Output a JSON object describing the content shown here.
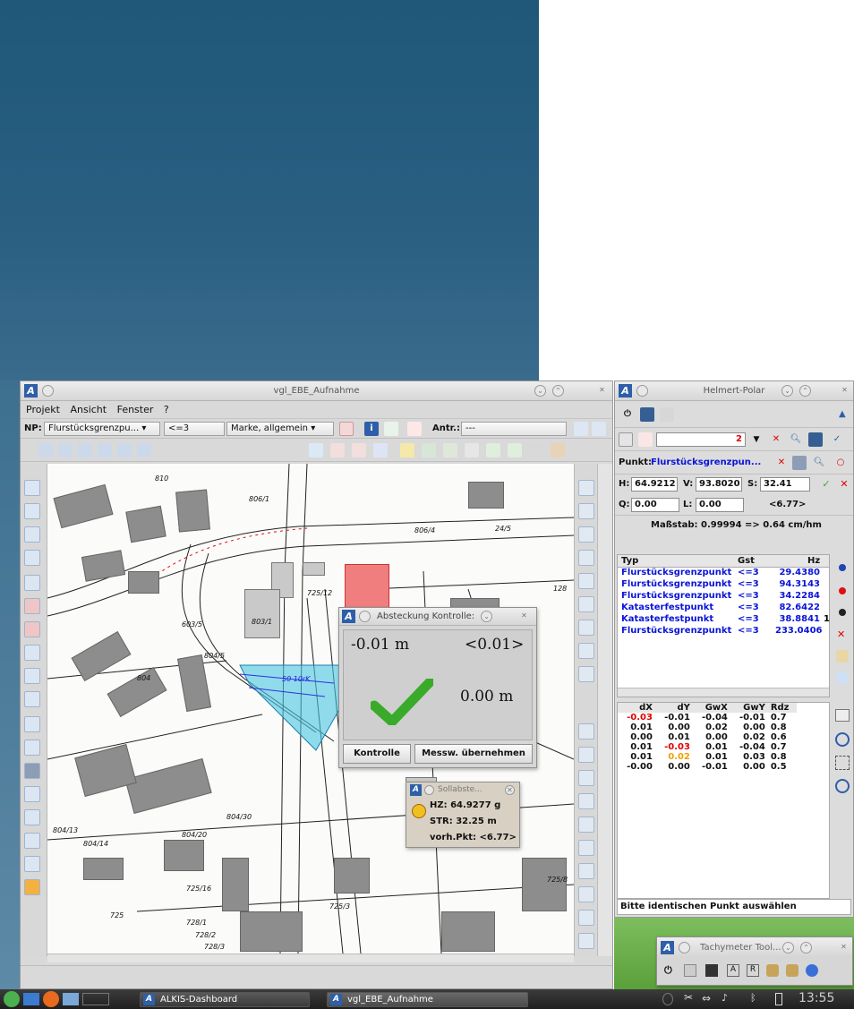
{
  "main_window": {
    "title": "vgl_EBE_Aufnahme",
    "menu": [
      "Projekt",
      "Ansicht",
      "Fenster",
      "?"
    ],
    "np_label": "NP:",
    "np_value": "Flurstücksgrenzpu...",
    "filter_value": "<=3",
    "marker_value": "Marke, allgemein",
    "antr_label": "Antr.:",
    "antr_value": "---"
  },
  "map_labels": [
    "810",
    "806/1",
    "806/4",
    "24/5",
    "725/12",
    "803/1",
    "128",
    "804",
    "603/5",
    "804/5",
    "804/13",
    "804/14",
    "804/20",
    "804/30",
    "725/3",
    "725/16",
    "725",
    "728/1",
    "728/2",
    "728/3",
    "725/8",
    "50 10rK"
  ],
  "absteckung": {
    "title": "Absteckung Kontrolle:",
    "value1": "-0.01 m",
    "value2": "<0.01>",
    "value3": "0.00 m",
    "button_kontrolle": "Kontrolle",
    "button_uebernehmen": "Messw. übernehmen"
  },
  "sollabsteckung": {
    "title": "Sollabste...",
    "hz": "HZ: 64.9277 g",
    "str": "STR: 32.25 m",
    "vorh": "vorh.Pkt: <6.77>"
  },
  "helmert": {
    "title": "Helmert-Polar",
    "combo_value": "2",
    "punkt_label": "Punkt:",
    "punkt_value": "Flurstücksgrenzpun...",
    "h_label": "H:",
    "h_value": "64.9212",
    "v_label": "V:",
    "v_value": "93.8020",
    "s_label": "S:",
    "s_value": "32.41",
    "q_label": "Q:",
    "q_value": "0.00",
    "l_label": "L:",
    "l_value": "0.00",
    "extra": "<6.77>",
    "massstab": "Maßstab: 0.99994 => 0.64 cm/hm",
    "columns": [
      "Typ",
      "Gst",
      "Hz"
    ],
    "rows": [
      {
        "typ": "Flurstücksgrenzpunkt",
        "gst": "<=3",
        "hz": "29.4380"
      },
      {
        "typ": "Flurstücksgrenzpunkt",
        "gst": "<=3",
        "hz": "94.3143"
      },
      {
        "typ": "Flurstücksgrenzpunkt",
        "gst": "<=3",
        "hz": "34.2284"
      },
      {
        "typ": "Katasterfestpunkt",
        "gst": "<=3",
        "hz": "82.6422"
      },
      {
        "typ": "Katasterfestpunkt",
        "gst": "<=3",
        "hz": "38.8841"
      },
      {
        "typ": "Flurstücksgrenzpunkt",
        "gst": "<=3",
        "hz": "233.0406"
      }
    ],
    "row_extra": "1",
    "diff_columns": [
      "dX",
      "dY",
      "GwX",
      "GwY",
      "Rdz"
    ],
    "diff_rows": [
      [
        "-0.03",
        "-0.01",
        "-0.04",
        "-0.01",
        "0.7"
      ],
      [
        "0.01",
        "0.00",
        "0.02",
        "0.00",
        "0.8"
      ],
      [
        "0.00",
        "0.01",
        "0.00",
        "0.02",
        "0.6"
      ],
      [
        "0.01",
        "-0.03",
        "0.01",
        "-0.04",
        "0.7"
      ],
      [
        "0.01",
        "0.02",
        "0.01",
        "0.03",
        "0.8"
      ],
      [
        "-0.00",
        "0.00",
        "-0.01",
        "0.00",
        "0.5"
      ]
    ],
    "status": "Bitte identischen Punkt auswählen"
  },
  "tachymeter": {
    "title": "Tachymeter Tool..."
  },
  "taskbar": {
    "task1": "ALKIS-Dashboard",
    "task2": "vgl_EBE_Aufnahme",
    "clock": "13:55"
  },
  "colors": {
    "accent_blue": "#2e5fa8",
    "link_blue": "#0a14d8",
    "check_green": "#3aaa2a",
    "error_red": "#e00000",
    "selection_cyan": "#47c6e2"
  }
}
